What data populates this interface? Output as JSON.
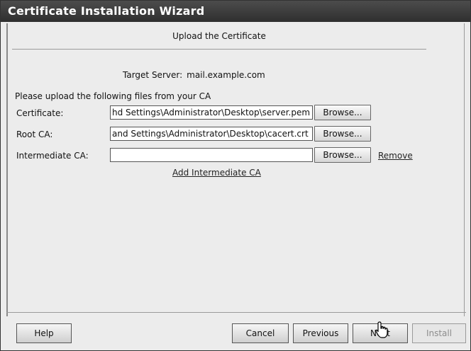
{
  "window": {
    "title": "Certificate Installation Wizard"
  },
  "step": {
    "title": "Upload the Certificate"
  },
  "target": {
    "label": "Target Server:",
    "value": "mail.example.com"
  },
  "instructions": "Please upload the following files from your CA",
  "rows": [
    {
      "label": "Certificate:",
      "value": "hd Settings\\Administrator\\Desktop\\server.pem",
      "browse_label": "Browse..."
    },
    {
      "label": "Root CA:",
      "value": "and Settings\\Administrator\\Desktop\\cacert.crt",
      "browse_label": "Browse..."
    },
    {
      "label": "Intermediate CA:",
      "value": "",
      "browse_label": "Browse...",
      "remove_label": "Remove"
    }
  ],
  "add_intermediate_label": "Add Intermediate CA",
  "footer": {
    "help": "Help",
    "cancel": "Cancel",
    "previous": "Previous",
    "next": "Next",
    "install": "Install"
  }
}
